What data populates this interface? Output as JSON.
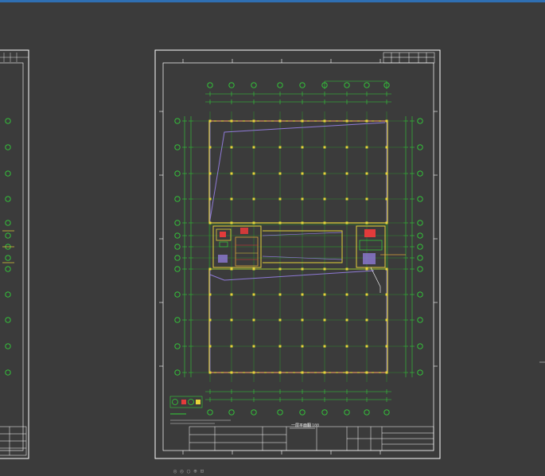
{
  "app": {
    "accent_color": "#2f6fb3",
    "background_color": "#3b3b3b"
  },
  "drawing": {
    "sheet_title": "一层平面图",
    "scale_note": "1:100",
    "colors": {
      "axis_green": "#33d13a",
      "wall_yellow": "#e6d23a",
      "grid_green": "#2f8a2f",
      "slab_purple": "#8e7ad6",
      "red_accent": "#e23b3b",
      "frame_white": "#ffffff"
    }
  },
  "status": {
    "text": "◎ ◎ ◯ ⊕ ⊡"
  }
}
